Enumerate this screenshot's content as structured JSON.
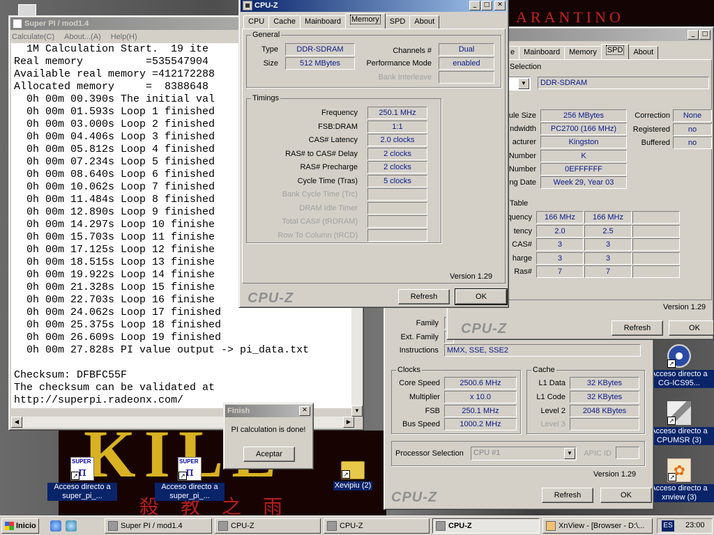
{
  "desktop": {
    "banner_text": "ARANTINO",
    "poster_title": "KILL",
    "poster_subtitle": "殺 教 之 雨",
    "icons": [
      {
        "label": "Acceso directo a super_pi_...",
        "icon": "super-pi-icon"
      },
      {
        "label": "Acceso directo a super_pi_...",
        "icon": "super-pi-icon"
      },
      {
        "label": "Xevipiu (2)",
        "icon": "folder-icon"
      },
      {
        "label": "Acceso directo a CG-ICS95...",
        "icon": "gear-icon"
      },
      {
        "label": "Acceso directo a CPUMSR (3)",
        "icon": "cpu-icon"
      },
      {
        "label": "Acceso directo a xnview (3)",
        "icon": "xnview-icon"
      }
    ]
  },
  "superpi": {
    "title": "Super PI / mod1.4",
    "menu": [
      "Calculate(C)",
      "About...(A)",
      "Help(H)"
    ],
    "lines": [
      "  1M Calculation Start.  19 ite",
      "Real memory          =535547904",
      "Available real memory =412172288",
      "Allocated memory     =  8388648",
      "  0h 00m 00.390s The initial val",
      "  0h 00m 01.593s Loop 1 finished",
      "  0h 00m 03.000s Loop 2 finished",
      "  0h 00m 04.406s Loop 3 finished",
      "  0h 00m 05.812s Loop 4 finished",
      "  0h 00m 07.234s Loop 5 finished",
      "  0h 00m 08.640s Loop 6 finished",
      "  0h 00m 10.062s Loop 7 finished",
      "  0h 00m 11.484s Loop 8 finished",
      "  0h 00m 12.890s Loop 9 finished",
      "  0h 00m 14.297s Loop 10 finishe",
      "  0h 00m 15.703s Loop 11 finishe",
      "  0h 00m 17.125s Loop 12 finishe",
      "  0h 00m 18.515s Loop 13 finishe",
      "  0h 00m 19.922s Loop 14 finishe",
      "  0h 00m 21.328s Loop 15 finishe",
      "  0h 00m 22.703s Loop 16 finishe",
      "  0h 00m 24.062s Loop 17 finished",
      "  0h 00m 25.375s Loop 18 finished",
      "  0h 00m 26.609s Loop 19 finished",
      "  0h 00m 27.828s PI value output -> pi_data.txt",
      "",
      "Checksum: DFBFC55F",
      "The checksum can be validated at",
      "http://superpi.radeonx.com/"
    ]
  },
  "finish": {
    "title": "Finish",
    "message": "PI calculation is done!",
    "button": "Aceptar"
  },
  "cpuz_mem": {
    "title": "CPU-Z",
    "tabs": [
      "CPU",
      "Cache",
      "Mainboard",
      "Memory",
      "SPD",
      "About"
    ],
    "active_tab": "Memory",
    "general_label": "General",
    "type_label": "Type",
    "type_value": "DDR-SDRAM",
    "size_label": "Size",
    "size_value": "512 MBytes",
    "channels_label": "Channels #",
    "channels_value": "Dual",
    "perf_label": "Performance Mode",
    "perf_value": "enabled",
    "bank_label": "Bank Interleave",
    "bank_value": "",
    "timings_label": "Timings",
    "timings": [
      {
        "label": "Frequency",
        "value": "250.1 MHz",
        "enabled": true
      },
      {
        "label": "FSB:DRAM",
        "value": "1:1",
        "enabled": true
      },
      {
        "label": "CAS# Latency",
        "value": "2.0 clocks",
        "enabled": true
      },
      {
        "label": "RAS# to CAS# Delay",
        "value": "2 clocks",
        "enabled": true
      },
      {
        "label": "RAS# Precharge",
        "value": "2 clocks",
        "enabled": true
      },
      {
        "label": "Cycle Time (Tras)",
        "value": "5 clocks",
        "enabled": true
      },
      {
        "label": "Bank Cycle Time (Trc)",
        "value": "",
        "enabled": false
      },
      {
        "label": "DRAM Idle Timer",
        "value": "",
        "enabled": false
      },
      {
        "label": "Total CAS# (tRDRAM)",
        "value": "",
        "enabled": false
      },
      {
        "label": "Row To Column (tRCD)",
        "value": "",
        "enabled": false
      }
    ],
    "version": "Version 1.29",
    "brand": "CPU-Z",
    "refresh": "Refresh",
    "ok": "OK"
  },
  "cpuz_spd": {
    "tabs": [
      "e",
      "Mainboard",
      "Memory",
      "SPD",
      "About"
    ],
    "active_tab": "SPD",
    "slot_label": "Selection",
    "slot_value": "DDR-SDRAM",
    "left_labels": [
      "ule Size",
      "ndwidth",
      "acturer",
      "Number",
      "Number",
      "ng Date"
    ],
    "left_values": [
      "256 MBytes",
      "PC2700 (166 MHz)",
      "Kingston",
      "K",
      "0EFFFFFF",
      "Week 29, Year 03"
    ],
    "right_labels": [
      "Correction",
      "Registered",
      "Buffered"
    ],
    "right_values": [
      "None",
      "no",
      "no"
    ],
    "table_label": "Table",
    "table_rows": [
      {
        "label": "quency",
        "v1": "166 MHz",
        "v2": "166 MHz"
      },
      {
        "label": "tency",
        "v1": "2.0",
        "v2": "2.5"
      },
      {
        "label": "CAS#",
        "v1": "3",
        "v2": "3"
      },
      {
        "label": "harge",
        "v1": "3",
        "v2": "3"
      },
      {
        "label": "Ras#",
        "v1": "7",
        "v2": "7"
      }
    ],
    "version": "Version 1.29",
    "brand": "CPU-Z",
    "refresh": "Refresh",
    "ok": "OK"
  },
  "cpuz_cpu": {
    "family_label": "Family",
    "ext_family_label": "Ext. Family",
    "instructions_label": "Instructions",
    "instructions_value": "MMX, SSE, SSE2",
    "clocks_label": "Clocks",
    "core_speed_label": "Core Speed",
    "core_speed": "2500.6 MHz",
    "multiplier_label": "Multiplier",
    "multiplier": "x 10.0",
    "fsb_label": "FSB",
    "fsb": "250.1 MHz",
    "bus_speed_label": "Bus Speed",
    "bus_speed": "1000.2 MHz",
    "cache_label": "Cache",
    "l1d_label": "L1 Data",
    "l1d": "32 KBytes",
    "l1c_label": "L1 Code",
    "l1c": "32 KBytes",
    "l2_label": "Level 2",
    "l2": "2048 KBytes",
    "l3_label": "Level 3",
    "l3": "",
    "proc_sel_label": "Processor Selection",
    "proc_sel_value": "CPU #1",
    "apic_label": "APIC ID",
    "apic_value": "",
    "version": "Version 1.29",
    "brand": "CPU-Z",
    "refresh": "Refresh",
    "ok": "OK"
  },
  "taskbar": {
    "start": "Inicio",
    "tasks": [
      {
        "label": "Super PI / mod1.4",
        "active": false
      },
      {
        "label": "CPU-Z",
        "active": false
      },
      {
        "label": "CPU-Z",
        "active": false
      },
      {
        "label": "CPU-Z",
        "active": true
      },
      {
        "label": "XnView - [Browser - D:\\...",
        "active": false
      }
    ],
    "lang": "ES",
    "clock": "23:00"
  }
}
